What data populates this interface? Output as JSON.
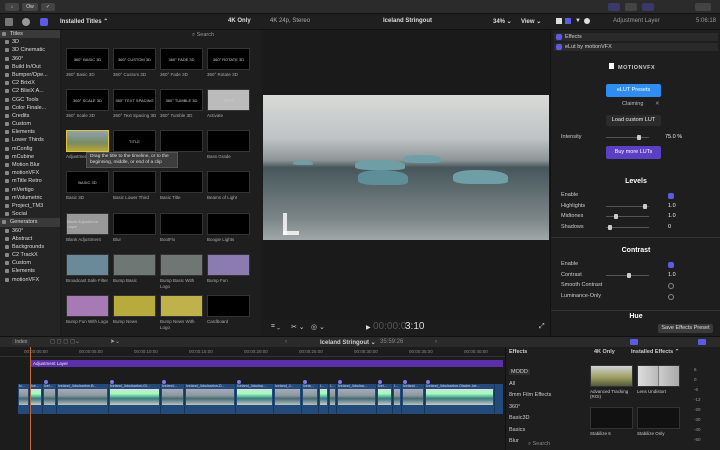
{
  "toolbar": {
    "import_label": "↓",
    "keyword_label": "Ow",
    "save_label": "✓"
  },
  "browser": {
    "filter_label": "Installed Titles ⌃",
    "fourk_label": "4K Only",
    "search_placeholder": "Search",
    "sidebar": [
      {
        "label": "Titles",
        "head": true
      },
      {
        "label": "3D"
      },
      {
        "label": "3D Cinematic"
      },
      {
        "label": "360°"
      },
      {
        "label": "Build In/Out"
      },
      {
        "label": "Bumper/Ope..."
      },
      {
        "label": "C2 BrixiX"
      },
      {
        "label": "C2 BlixiX A..."
      },
      {
        "label": "CGC Tools"
      },
      {
        "label": "Color Finale..."
      },
      {
        "label": "Credits"
      },
      {
        "label": "Custom"
      },
      {
        "label": "Elements"
      },
      {
        "label": "Lower Thirds"
      },
      {
        "label": "mConfig"
      },
      {
        "label": "mCubine"
      },
      {
        "label": "Motion Blur"
      },
      {
        "label": "motionVFX"
      },
      {
        "label": "mTitle Retro"
      },
      {
        "label": "mVertigo"
      },
      {
        "label": "mVolumetric"
      },
      {
        "label": "Project_TM3"
      },
      {
        "label": "Social"
      },
      {
        "label": "Generators",
        "head": true
      },
      {
        "label": "360°"
      },
      {
        "label": "Abstract"
      },
      {
        "label": "Backgrounds"
      },
      {
        "label": "C2 TrackX"
      },
      {
        "label": "Custom"
      },
      {
        "label": "Elements"
      },
      {
        "label": "motionVFX"
      }
    ],
    "tiles": [
      {
        "label": "360° Basic 3D",
        "thumb": "360° BASIC 3D"
      },
      {
        "label": "360° Custom 3D",
        "thumb": "360° CUSTOM 3D"
      },
      {
        "label": "360° Fade 3D",
        "thumb": "360° FADE 3D"
      },
      {
        "label": "360° Rotate 3D",
        "thumb": "360° ROTATE 3D"
      },
      {
        "label": "360° Scale 3D",
        "thumb": "360° SCALE 3D"
      },
      {
        "label": "360° Text Spacing 3D",
        "thumb": "360° TEXT SPACING"
      },
      {
        "label": "360° Tumble 3D",
        "thumb": "360° TUMBLE 3D"
      },
      {
        "label": "Activate",
        "thumb": "TEXT"
      },
      {
        "label": "Adjustment Layer",
        "thumb": "",
        "selected": true
      },
      {
        "label": "",
        "thumb": "TITLE"
      },
      {
        "label": "",
        "thumb": ""
      },
      {
        "label": "Bass Grade",
        "thumb": ""
      },
      {
        "label": "Basic 3D",
        "thumb": "BASIC 3D"
      },
      {
        "label": "Basic Lower Third",
        "thumb": ""
      },
      {
        "label": "Basic Title",
        "thumb": ""
      },
      {
        "label": "Beams of Light",
        "thumb": ""
      },
      {
        "label": "Blank Adjustment",
        "thumb": "Blank Adjustment Layer"
      },
      {
        "label": "Blur",
        "thumb": ""
      },
      {
        "label": "BootFix",
        "thumb": ""
      },
      {
        "label": "Boogie Lights",
        "thumb": ""
      },
      {
        "label": "Broadcast Safe Filter",
        "thumb": ""
      },
      {
        "label": "Bump Basic",
        "thumb": ""
      },
      {
        "label": "Bump Basic With Logo",
        "thumb": ""
      },
      {
        "label": "Bump Fun",
        "thumb": ""
      },
      {
        "label": "Bump Fun With Logo",
        "thumb": ""
      },
      {
        "label": "Bump News",
        "thumb": ""
      },
      {
        "label": "Bump News With Logo",
        "thumb": ""
      },
      {
        "label": "Cardboard",
        "thumb": ""
      }
    ],
    "tooltip": "Drag the title to the timeline, or to the beginning, middle, or end of a clip"
  },
  "viewer": {
    "format": "4K 24p, Stereo",
    "project": "Iceland Stringout",
    "zoom": "34% ⌄",
    "view": "View ⌄",
    "timecode_dim": "00:00:0",
    "timecode": "3:10"
  },
  "inspector": {
    "title": "Adjustment Layer",
    "duration": "5:06:18",
    "effects_label": "Effects",
    "effect_name": "eLut by motionVFX",
    "brand": "MOTIONVFX",
    "presets_btn": "eLUT Presets",
    "preset_value": "Claiming",
    "preset_clear": "✕",
    "load_btn": "Load custom LUT",
    "intensity_label": "Intensity",
    "intensity_value": "75.0  %",
    "intensity": 0.75,
    "buy_btn": "Buy more LUTs",
    "levels": {
      "title": "Levels",
      "rows": [
        {
          "label": "Enable",
          "type": "check",
          "on": true
        },
        {
          "label": "Highlights",
          "type": "slider",
          "value": "1.0",
          "pos": 0.9
        },
        {
          "label": "Midtones",
          "type": "slider",
          "value": "1.0",
          "pos": 0.2
        },
        {
          "label": "Shadows",
          "type": "slider",
          "value": "0",
          "pos": 0.05
        }
      ]
    },
    "contrast": {
      "title": "Contrast",
      "rows": [
        {
          "label": "Enable",
          "type": "check",
          "on": true
        },
        {
          "label": "Contrast",
          "type": "slider",
          "value": "1.0",
          "pos": 0.5
        },
        {
          "label": "Smooth Contrast",
          "type": "check",
          "on": false
        },
        {
          "label": "Luminance-Only",
          "type": "check",
          "on": false
        }
      ]
    },
    "hue_title": "Hue",
    "save_preset": "Save Effects Preset"
  },
  "timeline": {
    "index_label": "Index",
    "project": "Iceland Stringout ⌄",
    "duration": "35:59:26",
    "ruler": [
      "00:00:00:00",
      "00:00:05:00",
      "00:00:10:00",
      "00:00:15:00",
      "00:00:20:00",
      "00:00:25:00",
      "00:00:30:00",
      "00:00:35:00",
      "00:00:40:00",
      "00:00:45:00"
    ],
    "adjustment_clip": "Adjustment Layer",
    "clips": [
      "Ic...",
      "Ice...",
      "Icel...",
      "Iceland_JokulsarIon-B...",
      "Iceland_JokulsarIon-Gl...",
      "Iceland...",
      "Iceland_Jokulsarlon-D...",
      "Iceland_Jokulsa...",
      "Iceland_J...",
      "Icela...",
      "I...",
      "I...",
      "Iceland_Jokulsa...",
      "Icel...",
      "I...",
      "Iceland...",
      "Iceland_JokulsarIon-Glacier-Ice..."
    ]
  },
  "effects": {
    "title": "Effects",
    "fourk_label": "4K Only",
    "filter_label": "Installed Effects ⌃",
    "categories": [
      "MODD",
      "All",
      "8mm Film Effects",
      "360°",
      "Basic3D",
      "Basics",
      "Blur"
    ],
    "items": [
      {
        "label": "Advanced Tracking (ROI)"
      },
      {
        "label": "Lens Undistort"
      },
      {
        "label": "Stabilize 6"
      },
      {
        "label": "Stabilize Only"
      }
    ],
    "search_placeholder": "Search",
    "meter_ticks": [
      "6",
      "0",
      "-6",
      "-12",
      "-20",
      "-30",
      "-40",
      "-50"
    ]
  },
  "colors": {
    "accent": "#5b5ce6",
    "selection": "#e3c53a",
    "clip": "#244a7a",
    "adjustment": "#5a2fa8",
    "presets_btn": "#2f8cf0",
    "buy_btn": "#5b3fc4"
  }
}
